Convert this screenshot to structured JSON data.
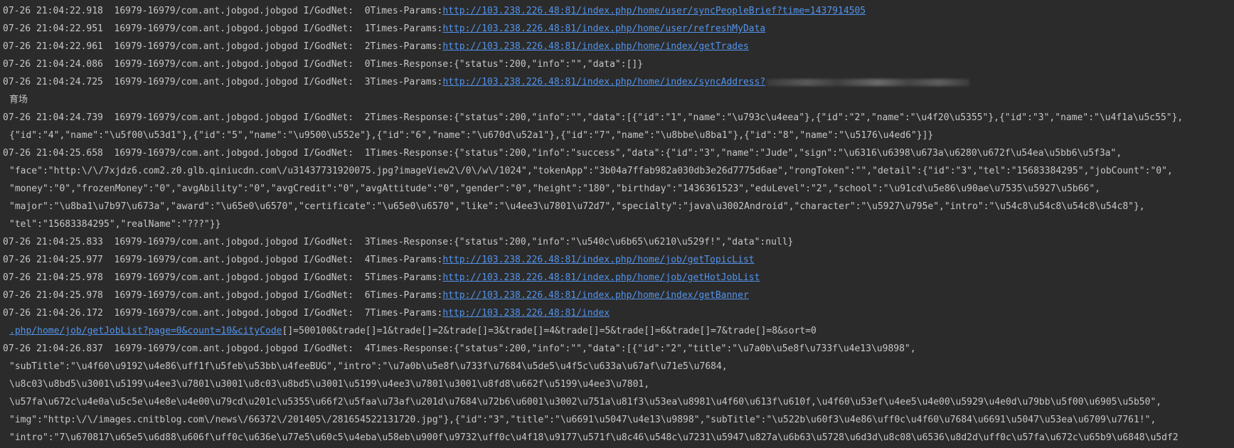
{
  "log_lines": [
    {
      "prefix": "07-26 21:04:22.918  16979-16979/com.ant.jobgod.jobgod I/GodNet:  0Times-Params:",
      "link": "http://103.238.226.48:81/index.php/home/user/syncPeopleBrief?time=1437914505",
      "suffix": ""
    },
    {
      "prefix": "07-26 21:04:22.951  16979-16979/com.ant.jobgod.jobgod I/GodNet:  1Times-Params:",
      "link": "http://103.238.226.48:81/index.php/home/user/refreshMyData",
      "suffix": ""
    },
    {
      "prefix": "07-26 21:04:22.961  16979-16979/com.ant.jobgod.jobgod I/GodNet:  2Times-Params:",
      "link": "http://103.238.226.48:81/index.php/home/index/getTrades",
      "suffix": ""
    },
    {
      "prefix": "07-26 21:04:24.086  16979-16979/com.ant.jobgod.jobgod I/GodNet:  0Times-Response:{\"status\":200,\"info\":\"\",\"data\":[]}",
      "link": "",
      "suffix": ""
    },
    {
      "prefix": "07-26 21:04:24.725  16979-16979/com.ant.jobgod.jobgod I/GodNet:  3Times-Params:",
      "link": "http://103.238.226.48:81/index.php/home/index/syncAddress?",
      "suffix": ""
    },
    {
      "prefix": "育场",
      "link": "",
      "suffix": "",
      "cont": true
    },
    {
      "prefix": "07-26 21:04:24.739  16979-16979/com.ant.jobgod.jobgod I/GodNet:  2Times-Response:{\"status\":200,\"info\":\"\",\"data\":[{\"id\":\"1\",\"name\":\"\\u793c\\u4eea\"},{\"id\":\"2\",\"name\":\"\\u4f20\\u5355\"},{\"id\":\"3\",\"name\":\"\\u4f1a\\u5c55\"},",
      "link": "",
      "suffix": ""
    },
    {
      "prefix": "{\"id\":\"4\",\"name\":\"\\u5f00\\u53d1\"},{\"id\":\"5\",\"name\":\"\\u9500\\u552e\"},{\"id\":\"6\",\"name\":\"\\u670d\\u52a1\"},{\"id\":\"7\",\"name\":\"\\u8bbe\\u8ba1\"},{\"id\":\"8\",\"name\":\"\\u5176\\u4ed6\"}]}",
      "link": "",
      "suffix": "",
      "cont": true
    },
    {
      "prefix": "07-26 21:04:25.658  16979-16979/com.ant.jobgod.jobgod I/GodNet:  1Times-Response:{\"status\":200,\"info\":\"success\",\"data\":{\"id\":\"3\",\"name\":\"Jude\",\"sign\":\"\\u6316\\u6398\\u673a\\u6280\\u672f\\u54ea\\u5bb6\\u5f3a\",",
      "link": "",
      "suffix": ""
    },
    {
      "prefix": "\"face\":\"http:\\/\\/7xjdz6.com2.z0.glb.qiniucdn.com\\/u31437731920075.jpg?imageView2\\/0\\/w\\/1024\",\"tokenApp\":\"3b04a7ffab982a030db3e26d7775d6ae\",\"rongToken\":\"\",\"detail\":{\"id\":\"3\",\"tel\":\"15683384295\",\"jobCount\":\"0\",",
      "link": "",
      "suffix": "",
      "cont": true
    },
    {
      "prefix": "\"money\":\"0\",\"frozenMoney\":\"0\",\"avgAbility\":\"0\",\"avgCredit\":\"0\",\"avgAttitude\":\"0\",\"gender\":\"0\",\"height\":\"180\",\"birthday\":\"1436361523\",\"eduLevel\":\"2\",\"school\":\"\\u91cd\\u5e86\\u90ae\\u7535\\u5927\\u5b66\",",
      "link": "",
      "suffix": "",
      "cont": true
    },
    {
      "prefix": "\"major\":\"\\u8ba1\\u7b97\\u673a\",\"award\":\"\\u65e0\\u6570\",\"certificate\":\"\\u65e0\\u6570\",\"like\":\"\\u4ee3\\u7801\\u72d7\",\"specialty\":\"java\\u3002Android\",\"character\":\"\\u5927\\u795e\",\"intro\":\"\\u54c8\\u54c8\\u54c8\\u54c8\"},",
      "link": "",
      "suffix": "",
      "cont": true
    },
    {
      "prefix": "\"tel\":\"15683384295\",\"realName\":\"???\"}}",
      "link": "",
      "suffix": "",
      "cont": true
    },
    {
      "prefix": "07-26 21:04:25.833  16979-16979/com.ant.jobgod.jobgod I/GodNet:  3Times-Response:{\"status\":200,\"info\":\"\\u540c\\u6b65\\u6210\\u529f!\",\"data\":null}",
      "link": "",
      "suffix": ""
    },
    {
      "prefix": "07-26 21:04:25.977  16979-16979/com.ant.jobgod.jobgod I/GodNet:  4Times-Params:",
      "link": "http://103.238.226.48:81/index.php/home/job/getTopicList",
      "suffix": ""
    },
    {
      "prefix": "07-26 21:04:25.978  16979-16979/com.ant.jobgod.jobgod I/GodNet:  5Times-Params:",
      "link": "http://103.238.226.48:81/index.php/home/job/getHotJobList",
      "suffix": ""
    },
    {
      "prefix": "07-26 21:04:25.978  16979-16979/com.ant.jobgod.jobgod I/GodNet:  6Times-Params:",
      "link": "http://103.238.226.48:81/index.php/home/index/getBanner",
      "suffix": ""
    },
    {
      "prefix": "07-26 21:04:26.172  16979-16979/com.ant.jobgod.jobgod I/GodNet:  7Times-Params:",
      "link": "http://103.238.226.48:81/index",
      "suffix": ""
    },
    {
      "prefix": "",
      "link": ".php/home/job/getJobList?page=0&count=10&cityCode",
      "suffix": "[]=500100&trade[]=1&trade[]=2&trade[]=3&trade[]=4&trade[]=5&trade[]=6&trade[]=7&trade[]=8&sort=0",
      "cont": true
    },
    {
      "prefix": "07-26 21:04:26.837  16979-16979/com.ant.jobgod.jobgod I/GodNet:  4Times-Response:{\"status\":200,\"info\":\"\",\"data\":[{\"id\":\"2\",\"title\":\"\\u7a0b\\u5e8f\\u733f\\u4e13\\u9898\",",
      "link": "",
      "suffix": ""
    },
    {
      "prefix": "\"subTitle\":\"\\u4f60\\u9192\\u4e86\\uff1f\\u5feb\\u53bb\\u4feeBUG\",\"intro\":\"\\u7a0b\\u5e8f\\u733f\\u7684\\u5de5\\u4f5c\\u633a\\u67af\\u71e5\\u7684,",
      "link": "",
      "suffix": "",
      "cont": true
    },
    {
      "prefix": "\\u8c03\\u8bd5\\u3001\\u5199\\u4ee3\\u7801\\u3001\\u8c03\\u8bd5\\u3001\\u5199\\u4ee3\\u7801\\u3001\\u8fd8\\u662f\\u5199\\u4ee3\\u7801,",
      "link": "",
      "suffix": "",
      "cont": true
    },
    {
      "prefix": "\\u57fa\\u672c\\u4e0a\\u5c5e\\u4e8e\\u4e00\\u79cd\\u201c\\u5355\\u66f2\\u5faa\\u73af\\u201d\\u7684\\u72b6\\u6001\\u3002\\u751a\\u81f3\\u53ea\\u8981\\u4f60\\u613f\\u610f,\\u4f60\\u53ef\\u4ee5\\u4e00\\u5929\\u4e0d\\u79bb\\u5f00\\u6905\\u5b50\",",
      "link": "",
      "suffix": "",
      "cont": true
    },
    {
      "prefix": "\"img\":\"http:\\/\\/images.cnitblog.com\\/news\\/66372\\/201405\\/281654522131720.jpg\"},{\"id\":\"3\",\"title\":\"\\u6691\\u5047\\u4e13\\u9898\",\"subTitle\":\"\\u522b\\u60f3\\u4e86\\uff0c\\u4f60\\u7684\\u6691\\u5047\\u53ea\\u6709\\u7761!\",",
      "link": "",
      "suffix": "",
      "cont": true
    },
    {
      "prefix": "\"intro\":\"7\\u670817\\u65e5\\u6d88\\u606f\\uff0c\\u636e\\u77e5\\u60c5\\u4eba\\u58eb\\u900f\\u9732\\uff0c\\u4f18\\u9177\\u571f\\u8c46\\u548c\\u7231\\u5947\\u827a\\u6b63\\u5728\\u6d3d\\u8c08\\u6536\\u8d2d\\uff0c\\u57fa\\u672c\\u65b9\\u6848\\u5df2",
      "link": "",
      "suffix": "",
      "cont": true
    }
  ]
}
